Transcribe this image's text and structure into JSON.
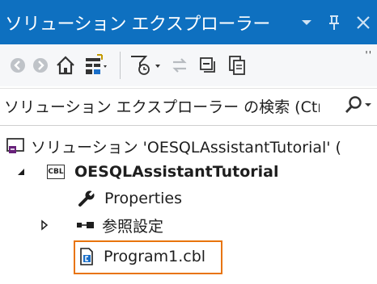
{
  "window": {
    "title": "ソリューション エクスプローラー",
    "controls": {
      "dropdown_icon": "chevron-down-icon",
      "pin_icon": "pin-icon",
      "close_icon": "close-icon"
    }
  },
  "toolbar": {
    "buttons": [
      {
        "name": "back-button",
        "icon": "back-arrow-icon"
      },
      {
        "name": "forward-button",
        "icon": "forward-arrow-icon"
      },
      {
        "name": "home-button",
        "icon": "home-icon"
      },
      {
        "name": "switch-views-button",
        "icon": "switch-views-icon"
      },
      {
        "name": "pending-changes-filter-button",
        "icon": "clock-filter-icon"
      },
      {
        "name": "sync-active-document-button",
        "icon": "sync-icon"
      },
      {
        "name": "collapse-all-button",
        "icon": "collapse-all-icon"
      },
      {
        "name": "show-all-files-button",
        "icon": "show-all-files-icon"
      }
    ],
    "overflow_label": "''"
  },
  "search": {
    "placeholder": "ソリューション エクスプローラー の検索 (Ctr",
    "icon": "search-icon"
  },
  "tree": {
    "solution": {
      "label": "ソリューション 'OESQLAssistantTutorial' (",
      "icon": "solution-icon"
    },
    "project": {
      "label": "OESQLAssistantTutorial",
      "badge": "CBL",
      "expanded": true
    },
    "items": [
      {
        "label": "Properties",
        "icon": "wrench-icon"
      },
      {
        "label": "参照設定",
        "icon": "references-icon",
        "expandable": true
      },
      {
        "label": "Program1.cbl",
        "icon": "cobol-file-icon",
        "selected": true
      }
    ]
  },
  "colors": {
    "titlebar": "#0e70c0",
    "toolbar_bg": "#f6f7f9",
    "selection_outline": "#e8740c",
    "icon_blue": "#1a6fc9",
    "icon_purple": "#68217a"
  }
}
